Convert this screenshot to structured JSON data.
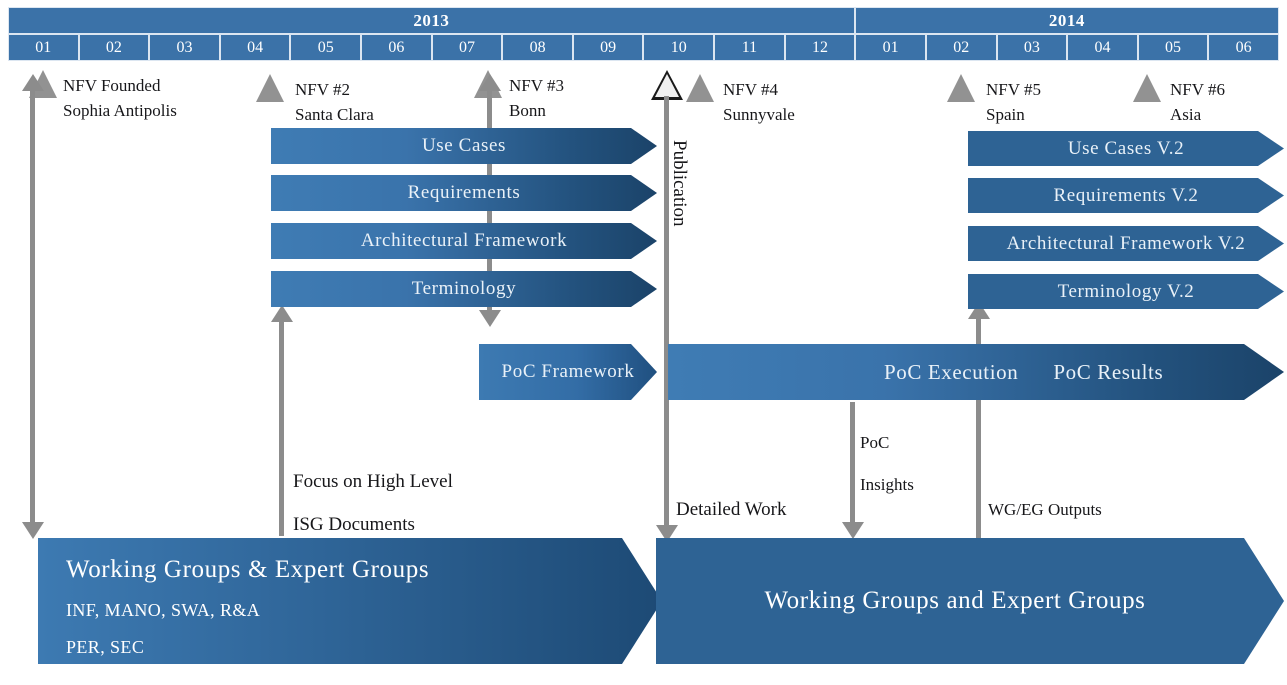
{
  "timeline": {
    "years": [
      {
        "label": "2013",
        "months": [
          "01",
          "02",
          "03",
          "04",
          "05",
          "06",
          "07",
          "08",
          "09",
          "10",
          "11",
          "12"
        ]
      },
      {
        "label": "2014",
        "months": [
          "01",
          "02",
          "03",
          "04",
          "05",
          "06"
        ]
      }
    ]
  },
  "milestones": [
    {
      "name": "nfv-founded",
      "line1": "NFV Founded",
      "line2": "Sophia Antipolis",
      "type": "filled"
    },
    {
      "name": "nfv-2",
      "line1": "NFV #2",
      "line2": "Santa Clara",
      "type": "filled"
    },
    {
      "name": "nfv-3",
      "line1": "NFV #3",
      "line2": "Bonn",
      "type": "filled"
    },
    {
      "name": "publication",
      "line1": "",
      "line2": "",
      "type": "open"
    },
    {
      "name": "nfv-4",
      "line1": "NFV #4",
      "line2": "Sunnyvale",
      "type": "filled"
    },
    {
      "name": "nfv-5",
      "line1": "NFV #5",
      "line2": "Spain",
      "type": "filled"
    },
    {
      "name": "nfv-6",
      "line1": "NFV #6",
      "line2": "Asia",
      "type": "filled"
    }
  ],
  "publication_label": "Publication",
  "workstreams_v1": [
    {
      "label": "Use Cases"
    },
    {
      "label": "Requirements"
    },
    {
      "label": "Architectural  Framework"
    },
    {
      "label": "Terminology"
    }
  ],
  "workstreams_v2": [
    {
      "label": "Use Cases V.2"
    },
    {
      "label": "Requirements V.2"
    },
    {
      "label": "Architectural  Framework V.2"
    },
    {
      "label": "Terminology V.2"
    }
  ],
  "poc": {
    "framework": "PoC Framework",
    "execution": "PoC Execution",
    "results": "PoC Results"
  },
  "notes": {
    "focus_line1": "Focus on High Level",
    "focus_line2": "ISG Documents",
    "detailed_work": "Detailed Work",
    "poc_insights_line1": "PoC",
    "poc_insights_line2": "Insights",
    "wg_eg_outputs": "WG/EG Outputs"
  },
  "groups": {
    "left": {
      "title": "Working Groups & Expert Groups",
      "sub1": "INF, MANO, SWA, R&A",
      "sub2": "PER, SEC"
    },
    "right": {
      "title": "Working Groups and Expert Groups"
    }
  },
  "colors": {
    "header_blue": "#3b72a8",
    "bar_light": "#3f7cb4",
    "bar_dark": "#1b4369",
    "solid_blue": "#2e6394",
    "arrow_gray": "#8c8c8c",
    "milestone_gray": "#929292"
  }
}
